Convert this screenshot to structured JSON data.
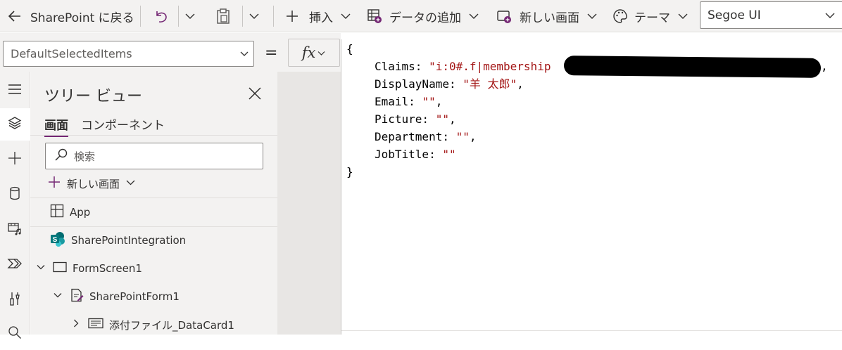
{
  "toolbar": {
    "back_label": "SharePoint に戻る",
    "insert_label": "挿入",
    "add_data_label": "データの追加",
    "new_screen_label": "新しい画面",
    "theme_label": "テーマ",
    "font_value": "Segoe UI"
  },
  "formula_bar": {
    "property": "DefaultSelectedItems",
    "equals": "=",
    "fx_label": "fx"
  },
  "code": {
    "open_brace": "{",
    "claims_key": "Claims: ",
    "claims_value": "\"i:0#.f|membership",
    "claims_trail": ",",
    "displayname_key": "DisplayName: ",
    "displayname_value": "\"羊 太郎\"",
    "displayname_trail": ",",
    "email_key": "Email: ",
    "email_value": "\"\"",
    "email_trail": ",",
    "picture_key": "Picture: ",
    "picture_value": "\"\"",
    "picture_trail": ",",
    "department_key": "Department: ",
    "department_value": "\"\"",
    "department_trail": ",",
    "jobtitle_key": "JobTitle: ",
    "jobtitle_value": "\"\"",
    "close_brace": "}"
  },
  "tree_view": {
    "title": "ツリー ビュー",
    "tabs": [
      "画面",
      "コンポーネント"
    ],
    "search_placeholder": "検索",
    "new_screen_label": "新しい画面",
    "nodes": [
      "App",
      "SharePointIntegration",
      "FormScreen1",
      "SharePointForm1",
      "添付ファイル_DataCard1"
    ]
  },
  "colors": {
    "accent": "#742774",
    "string": "#a31515",
    "chrome": "#f3f2f1"
  }
}
